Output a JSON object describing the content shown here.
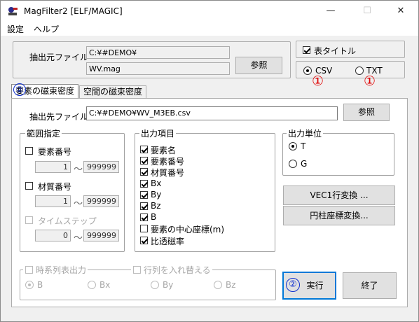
{
  "window": {
    "title": "MagFilter2  [ELF/MAGIC]",
    "minimize": "—",
    "maximize": "☐",
    "close": "✕"
  },
  "menu": {
    "settings": "設定",
    "help": "ヘルプ"
  },
  "source": {
    "label": "抽出元ファイル",
    "path": "C:¥#DEMO¥",
    "file": "WV.mag",
    "browse": "参照"
  },
  "options": {
    "header_title_label": "表タイトル",
    "header_title_checked": true,
    "csv_label": "CSV",
    "txt_label": "TXT",
    "selected": "CSV"
  },
  "annotations": {
    "circle_1a": "①",
    "circle_1b": "①",
    "circle_2a": "②",
    "circle_2b": "②"
  },
  "tabs": [
    {
      "label": "要素の磁束密度",
      "active": true
    },
    {
      "label": "空間の磁束密度",
      "active": false
    }
  ],
  "dest": {
    "label": "抽出先ファイル",
    "path": "C:¥#DEMO¥WV_M3EB.csv",
    "browse": "参照"
  },
  "range": {
    "title": "範囲指定",
    "element": {
      "label": "要素番号",
      "from": "1",
      "to": "999999"
    },
    "material": {
      "label": "材質番号",
      "from": "1",
      "to": "999999"
    },
    "timestep": {
      "label": "タイムステップ",
      "from": "0",
      "to": "999999"
    },
    "sep": "～"
  },
  "output_items": {
    "title": "出力項目",
    "items": [
      {
        "label": "要素名",
        "checked": true
      },
      {
        "label": "要素番号",
        "checked": true
      },
      {
        "label": "材質番号",
        "checked": true
      },
      {
        "label": "Bx",
        "checked": true
      },
      {
        "label": "By",
        "checked": true
      },
      {
        "label": "Bz",
        "checked": true
      },
      {
        "label": "B",
        "checked": true
      },
      {
        "label": "要素の中心座標(m)",
        "checked": false
      },
      {
        "label": "比透磁率",
        "checked": true
      }
    ]
  },
  "unit": {
    "title": "出力単位",
    "t_label": "T",
    "g_label": "G",
    "selected": "T"
  },
  "buttons": {
    "vec": "VEC1行変換 ...",
    "cyl": "円柱座標変換...",
    "run": "実行",
    "exit": "終了"
  },
  "timeseries": {
    "label": "時系列表出力",
    "swap_label": "行列を入れ替える",
    "b": "B",
    "bx": "Bx",
    "by": "By",
    "bz": "Bz",
    "selected": "B"
  }
}
